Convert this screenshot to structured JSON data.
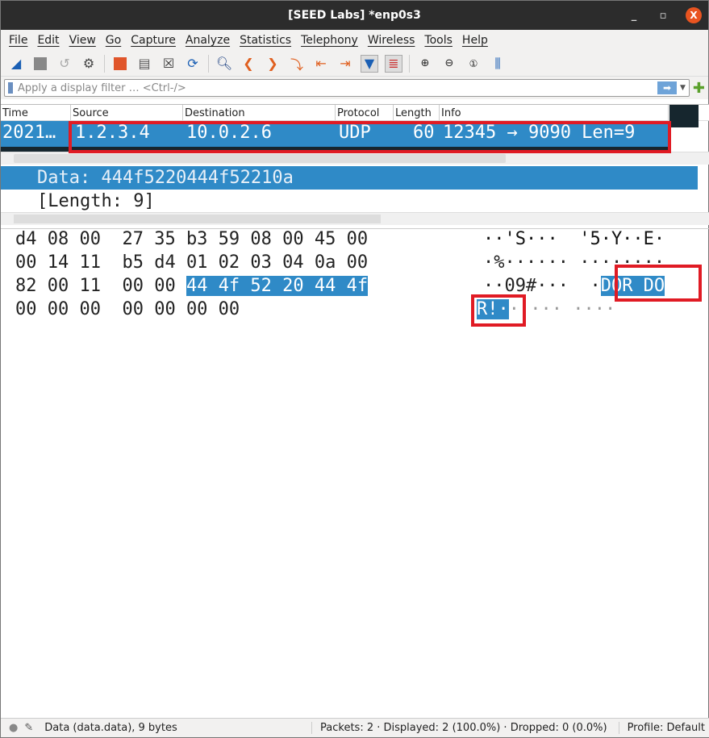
{
  "window": {
    "title": "[SEED Labs] *enp0s3",
    "minimize": "_",
    "maximize": "▫",
    "close": "X"
  },
  "menu": [
    "File",
    "Edit",
    "View",
    "Go",
    "Capture",
    "Analyze",
    "Statistics",
    "Telephony",
    "Wireless",
    "Tools",
    "Help"
  ],
  "toolbar": [
    "start-capture-icon",
    "stop-capture-icon",
    "restart-capture-icon",
    "capture-options-icon",
    "open-file-icon",
    "save-file-icon",
    "close-file-icon",
    "reload-file-icon",
    "find-packet-icon",
    "go-back-icon",
    "go-forward-icon",
    "go-to-packet-icon",
    "go-first-icon",
    "go-last-icon",
    "autoscroll-icon",
    "colorize-icon",
    "zoom-in-icon",
    "zoom-out-icon",
    "normal-size-icon",
    "resize-columns-icon"
  ],
  "filter": {
    "placeholder": "Apply a display filter … <Ctrl-/>"
  },
  "packet_list": {
    "columns": [
      "Time",
      "Source",
      "Destination",
      "Protocol",
      "Length",
      "Info"
    ],
    "rows": [
      {
        "time": "2021…",
        "source": "1.2.3.4",
        "destination": "10.0.2.6",
        "protocol": "UDP",
        "length": "60",
        "info": "12345 → 9090 Len=9"
      }
    ]
  },
  "details": {
    "data": "Data: 444f5220444f52210a",
    "length": "[Length: 9]"
  },
  "hex": {
    "rows": [
      {
        "hex_a": "d4 08 00",
        "hex_b": "27 35 b3 59 08 00 45 00",
        "ascii": "··'S···  '5·Y··E·"
      },
      {
        "hex_a": "00 14 11",
        "hex_b": "b5 d4 01 02 03 04 0a 00",
        "ascii": "·%······ ········"
      },
      {
        "hex_a": "82 00 11",
        "hex_b": "00 00",
        "hex_sel": "44 4f 52 20 44 4f",
        "ascii": "··09#···  ·",
        "ascii_sel": "DOR DO"
      },
      {
        "hex_a": "00 00 00",
        "hex_b": "00 00 00 00",
        "ascii_sel": "R!·",
        "ascii": "····· ····"
      }
    ]
  },
  "status": {
    "field": "Data (data.data), 9 bytes",
    "packets": "Packets: 2 · Displayed: 2 (100.0%) · Dropped: 0 (0.0%)",
    "profile": "Profile: Default"
  },
  "colors": {
    "selection": "#2f8ac7",
    "highlight_box": "#e01b24",
    "titlebar": "#2c2c2c"
  }
}
